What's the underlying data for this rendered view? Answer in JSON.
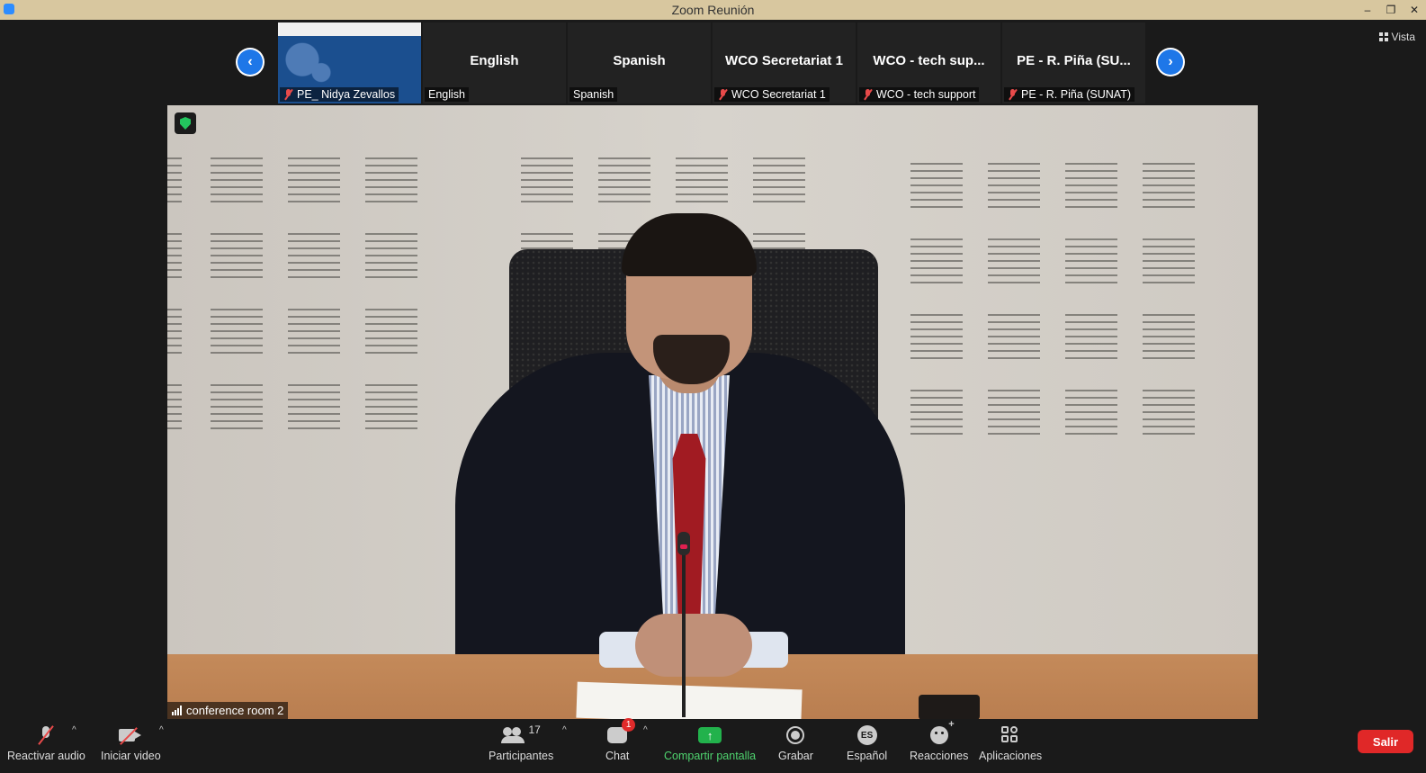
{
  "window": {
    "title": "Zoom Reunión",
    "minimize": "–",
    "restore": "❐",
    "close": "✕"
  },
  "top_bar": {
    "view_label": "Vista"
  },
  "nav": {
    "prev": "‹",
    "next": "›"
  },
  "thumbnails": [
    {
      "name": "",
      "label": "PE_ Nidya Zevallos",
      "muted": true,
      "type": "image"
    },
    {
      "name": "English",
      "label": "English",
      "muted": false
    },
    {
      "name": "Spanish",
      "label": "Spanish",
      "muted": false
    },
    {
      "name": "WCO Secretariat 1",
      "label": "WCO Secretariat 1",
      "muted": true
    },
    {
      "name": "WCO - tech sup...",
      "label": "WCO - tech support",
      "muted": true
    },
    {
      "name": "PE - R. Piña (SU...",
      "label": "PE - R. Piña (SUNAT)",
      "muted": true
    }
  ],
  "main_video": {
    "label": "conference room 2"
  },
  "toolbar": {
    "audio_label": "Reactivar audio",
    "video_label": "Iniciar video",
    "participants_label": "Participantes",
    "participants_count": "17",
    "chat_label": "Chat",
    "chat_badge": "1",
    "share_label": "Compartir pantalla",
    "record_label": "Grabar",
    "language_label": "Español",
    "language_code": "ES",
    "reactions_label": "Reacciones",
    "apps_label": "Aplicaciones",
    "leave_label": "Salir",
    "caret": "^"
  },
  "colors": {
    "accent": "#1e77e8",
    "share": "#22b24c",
    "leave": "#e02828",
    "titlebar": "#d8c79f"
  }
}
